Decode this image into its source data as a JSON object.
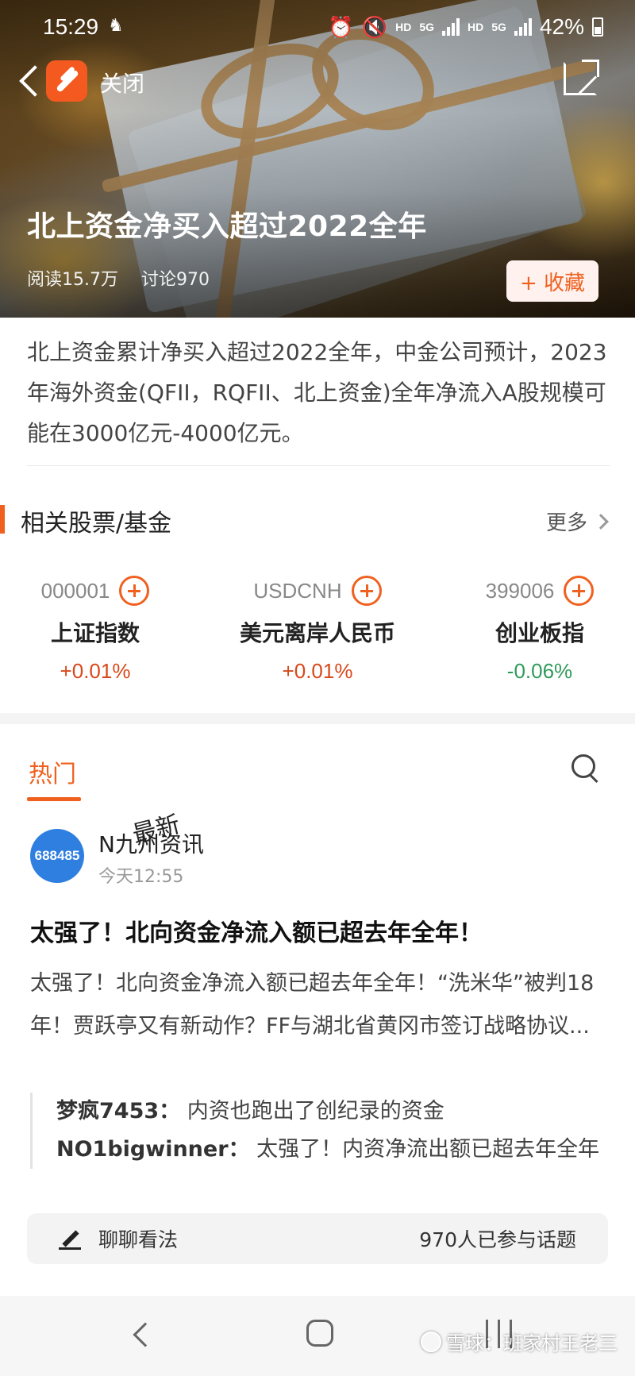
{
  "status_bar": {
    "time": "15:29",
    "net_hd_1": "HD",
    "net_5g_1": "5G",
    "net_hd_2": "HD",
    "net_5g_2": "5G",
    "battery": "42%"
  },
  "header": {
    "close_label": "关闭",
    "title": "北上资金净买入超过2022全年",
    "reads": "阅读15.7万",
    "comments": "讨论970",
    "favorite_label": "+ 收藏",
    "icons": [
      "back-icon",
      "app-logo-icon",
      "share-icon"
    ]
  },
  "summary": "北上资金累计净买入超过2022全年，中金公司预计，2023年海外资金(QFII，RQFII、北上资金)全年净流入A股规模可能在3000亿元-4000亿元。",
  "related": {
    "title": "相关股票/基金",
    "more_label": "更多",
    "items": [
      {
        "code": "000001",
        "name": "上证指数",
        "change": "+0.01%"
      },
      {
        "code": "USDCNH",
        "name": "美元离岸人民币",
        "change": "+0.01%"
      },
      {
        "code": "399006",
        "name": "创业板指",
        "change": "-0.06%"
      }
    ]
  },
  "tabs": {
    "hot": "热门",
    "latest": "最新"
  },
  "post": {
    "avatar_text": "688485",
    "author": "N九州资讯",
    "time": "今天12:55",
    "title": "太强了！北向资金净流入额已超去年全年！",
    "body": "太强了！北向资金净流入额已超去年全年！“洗米华”被判18年！贾跃亭又有新动作？FF与湖北省黄冈市签订战略协议...",
    "replies": [
      {
        "user": "梦疯7453：",
        "text": "内资也跑出了创纪录的资金"
      },
      {
        "user": "NO1bigwinner：",
        "text": "太强了！内资净流出额已超去年全年"
      }
    ]
  },
  "discussion": {
    "label": "聊聊看法",
    "participants": "970人已参与话题"
  },
  "watermark": "雪球：班家村王老三",
  "colors": {
    "accent": "#f0601f",
    "up": "#d9481a",
    "down": "#2f9b5a",
    "avatar": "#2f7fe0"
  }
}
